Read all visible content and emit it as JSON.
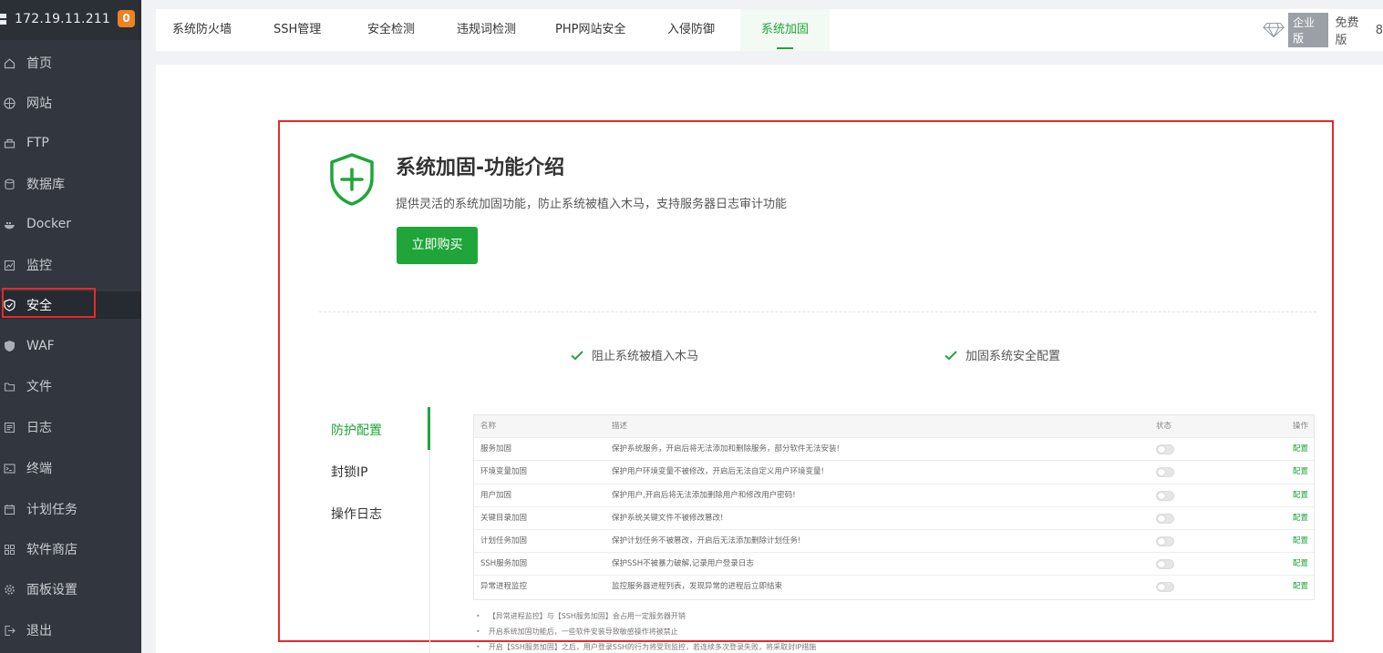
{
  "sidebar": {
    "server_ip": "172.19.11.211",
    "badge_count": "0",
    "items": [
      {
        "label": "首页",
        "icon": "home-icon"
      },
      {
        "label": "网站",
        "icon": "globe-icon"
      },
      {
        "label": "FTP",
        "icon": "ftp-icon"
      },
      {
        "label": "数据库",
        "icon": "database-icon"
      },
      {
        "label": "Docker",
        "icon": "docker-icon"
      },
      {
        "label": "监控",
        "icon": "monitor-icon"
      },
      {
        "label": "安全",
        "icon": "shield-check-icon",
        "active": true
      },
      {
        "label": "WAF",
        "icon": "shield-icon"
      },
      {
        "label": "文件",
        "icon": "folder-icon"
      },
      {
        "label": "日志",
        "icon": "log-icon"
      },
      {
        "label": "终端",
        "icon": "terminal-icon"
      },
      {
        "label": "计划任务",
        "icon": "calendar-icon"
      },
      {
        "label": "软件商店",
        "icon": "apps-icon"
      },
      {
        "label": "面板设置",
        "icon": "settings-icon"
      },
      {
        "label": "退出",
        "icon": "logout-icon"
      }
    ]
  },
  "tabs": [
    {
      "label": "系统防火墙"
    },
    {
      "label": "SSH管理"
    },
    {
      "label": "安全检测"
    },
    {
      "label": "违规词检测"
    },
    {
      "label": "PHP网站安全"
    },
    {
      "label": "入侵防御"
    },
    {
      "label": "系统加固",
      "active": true
    }
  ],
  "edition": {
    "enterprise_label": "企业版",
    "free_label": "免费版",
    "trailing": "8"
  },
  "intro": {
    "title": "系统加固-功能介绍",
    "description": "提供灵活的系统加固功能，防止系统被植入木马，支持服务器日志审计功能",
    "buy_button": "立即购买"
  },
  "features": [
    {
      "label": "阻止系统被植入木马"
    },
    {
      "label": "加固系统安全配置"
    }
  ],
  "side_menu": [
    {
      "label": "防护配置",
      "active": true
    },
    {
      "label": "封锁IP"
    },
    {
      "label": "操作日志"
    }
  ],
  "table": {
    "headers": {
      "name": "名称",
      "desc": "描述",
      "status": "状态",
      "action": "操作"
    },
    "rows": [
      {
        "name": "服务加固",
        "desc": "保护系统服务，开启后将无法添加和删除服务，部分软件无法安装!",
        "action": "配置"
      },
      {
        "name": "环境变量加固",
        "desc": "保护用户环境变量不被修改，开启后无法自定义用户环境变量!",
        "action": "配置"
      },
      {
        "name": "用户加固",
        "desc": "保护用户,开启后将无法添加删除用户和修改用户密码!",
        "action": "配置"
      },
      {
        "name": "关键目录加固",
        "desc": "保护系统关键文件不被修改篡改!",
        "action": "配置"
      },
      {
        "name": "计划任务加固",
        "desc": "保护计划任务不被篡改，开启后无法添加删除计划任务!",
        "action": "配置"
      },
      {
        "name": "SSH服务加固",
        "desc": "保护SSH不被暴力破解,记录用户登录日志",
        "action": "配置"
      },
      {
        "name": "异常进程监控",
        "desc": "监控服务器进程列表，发现异常的进程后立即结束",
        "action": "配置"
      }
    ]
  },
  "notes": [
    "【异常进程监控】与【SSH服务加固】会占用一定服务器开销",
    "开启系统加固功能后，一些软件安装导致敏感操作将被禁止",
    "开启【SSH服务加固】之后，用户登录SSH的行为将受到监控，若连续多次登录失败，将采取封IP措施"
  ],
  "colors": {
    "accent": "#20a53a",
    "sidebar_bg": "#32373f",
    "highlight_red": "#e32b2b",
    "badge_orange": "#f08120"
  }
}
